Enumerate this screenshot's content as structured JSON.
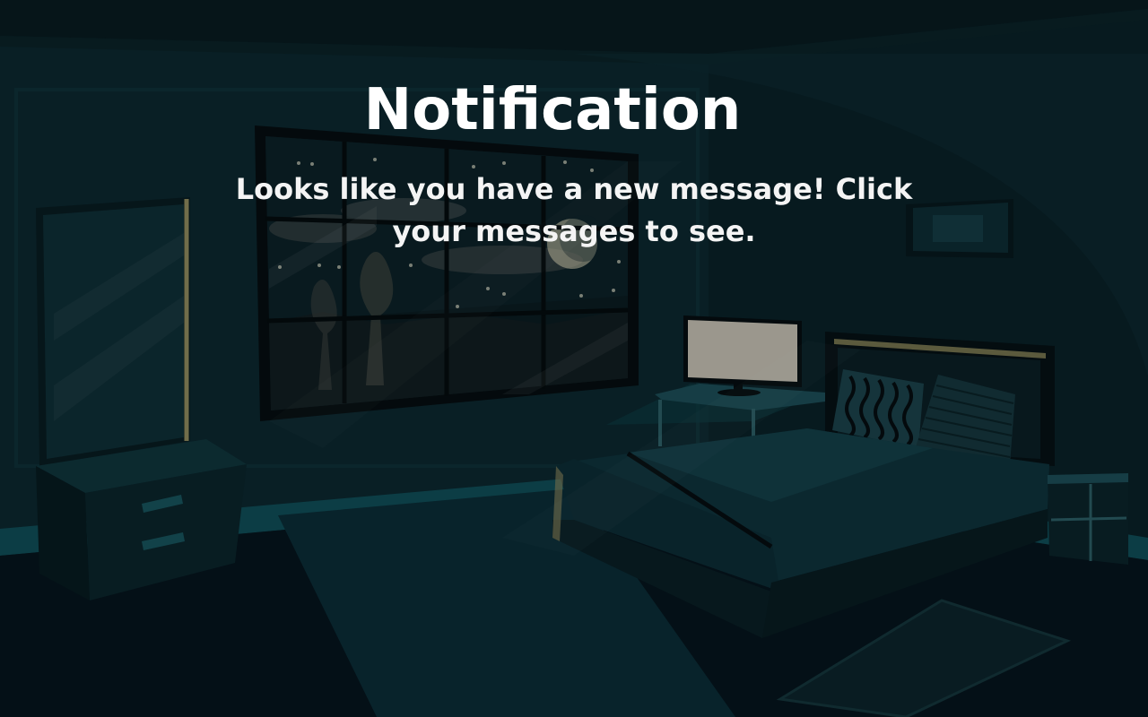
{
  "notification": {
    "title": "Notification",
    "message": "Looks like you have a new message! Click your messages to see."
  },
  "scene": {
    "setting": "dark-bedroom-night",
    "colors": {
      "wall": "#0c2a30",
      "wall_dark": "#081c21",
      "floor": "#06141c",
      "teal_accent": "#0e4a50",
      "window_frame": "#050c0e",
      "moon": "#d8d2b0",
      "monitor": "#cfc8b8",
      "trim": "#8a8458"
    },
    "icons": [
      "moon-icon",
      "monitor-icon"
    ]
  }
}
